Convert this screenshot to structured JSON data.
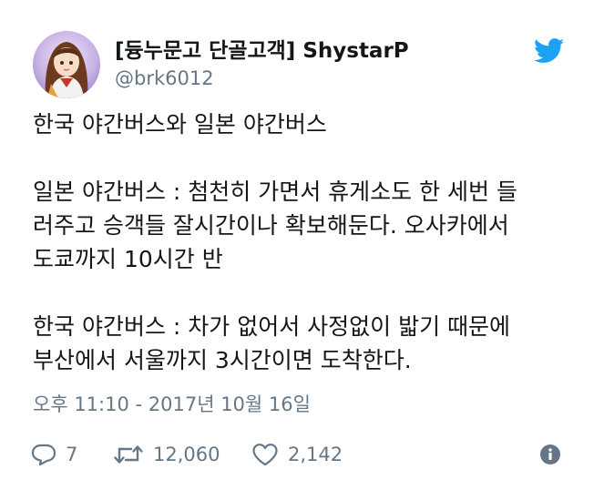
{
  "author": {
    "display_name": "[듕누문고 단골고객] ShystarP",
    "handle": "@brk6012"
  },
  "tweet": {
    "lines": [
      "한국 야간버스와 일본 야간버스",
      "",
      "일본 야간버스 : 첨천히 가면서 휴게소도 한 세번 들",
      "러주고 승객들 잘시간이나 확보해둔다. 오사카에서",
      "도쿄까지 10시간 반",
      "",
      "한국 야간버스 : 차가 없어서 사정없이 밟기 때문에",
      "부산에서 서울까지 3시간이면 도착한다."
    ],
    "timestamp": "오후 11:10 - 2017년 10월 16일"
  },
  "actions": {
    "reply_count": "7",
    "retweet_count": "12,060",
    "like_count": "2,142"
  },
  "icons": {
    "brand": "twitter-bird-icon",
    "reply": "reply-icon",
    "retweet": "retweet-icon",
    "like": "heart-icon",
    "info": "info-icon"
  },
  "colors": {
    "twitter_blue": "#1da1f2",
    "secondary_text": "#657786",
    "primary_text": "#14171a"
  }
}
